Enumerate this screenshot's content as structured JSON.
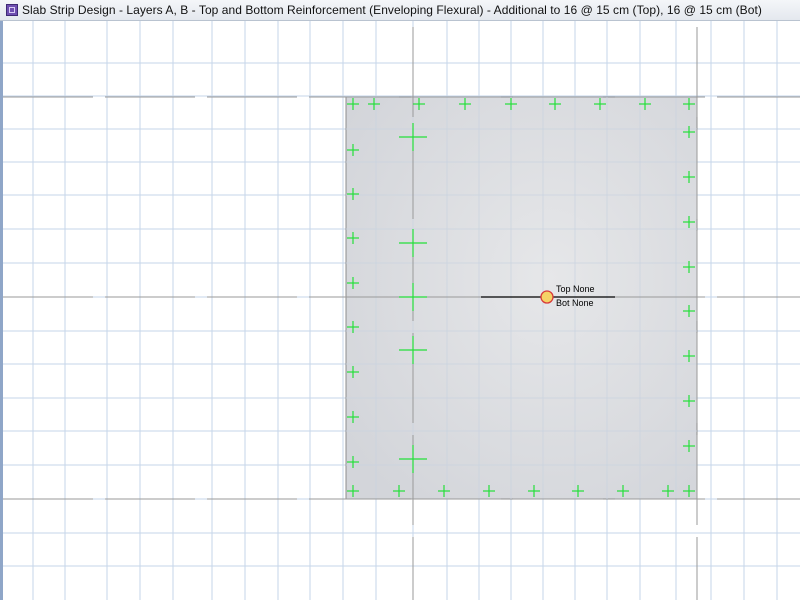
{
  "window": {
    "title": "Slab Strip Design - Layers A, B - Top and Bottom Reinforcement (Enveloping Flexural)  - Additional to 16 @ 15 cm (Top), 16 @ 15 cm (Bot)"
  },
  "strip_label": {
    "top": "Top None",
    "bottom": "Bot None"
  },
  "colors": {
    "grid": "#c5d5ea",
    "slab_fill": "#dcdde1",
    "marker": "#24e03a",
    "axis": "#9a9a9a",
    "strip_point": "#f3c433"
  }
}
